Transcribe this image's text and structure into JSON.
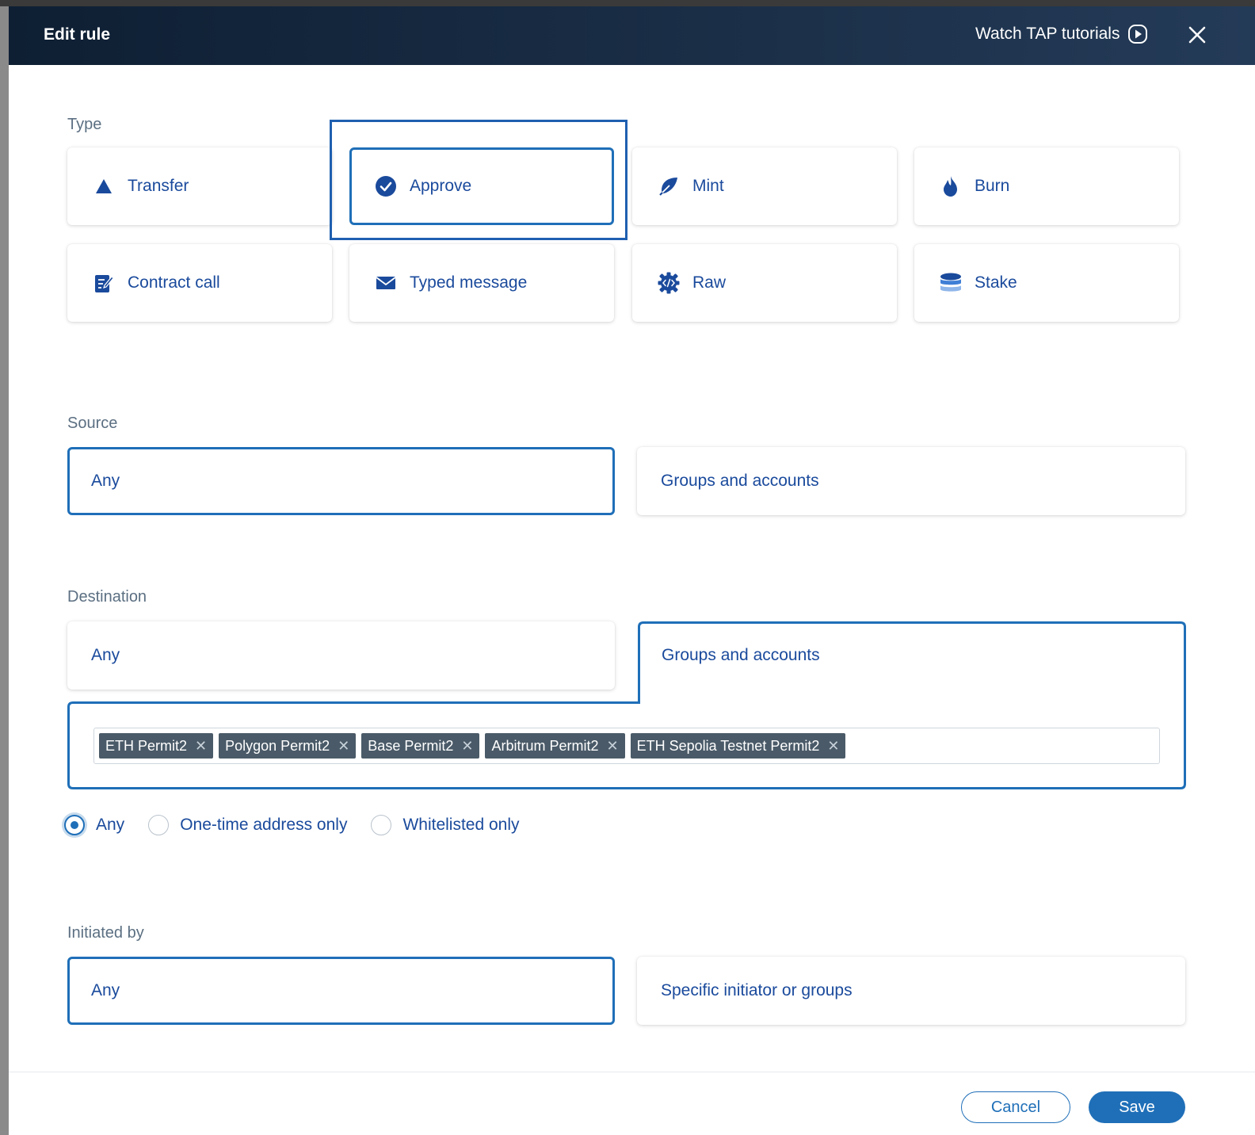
{
  "header": {
    "title": "Edit rule",
    "tutorials_label": "Watch TAP tutorials"
  },
  "type": {
    "label": "Type",
    "options": [
      {
        "label": "Transfer",
        "icon": "triangle-icon"
      },
      {
        "label": "Approve",
        "icon": "check-circle-icon",
        "selected": true
      },
      {
        "label": "Mint",
        "icon": "leaf-icon"
      },
      {
        "label": "Burn",
        "icon": "flame-icon"
      },
      {
        "label": "Contract call",
        "icon": "document-edit-icon"
      },
      {
        "label": "Typed message",
        "icon": "envelope-icon"
      },
      {
        "label": "Raw",
        "icon": "code-gear-icon"
      },
      {
        "label": "Stake",
        "icon": "database-stack-icon"
      }
    ]
  },
  "source": {
    "label": "Source",
    "options": [
      "Any",
      "Groups and accounts"
    ],
    "selected": "Any"
  },
  "destination": {
    "label": "Destination",
    "options": [
      "Any",
      "Groups and accounts"
    ],
    "selected": "Groups and accounts",
    "tags": [
      "ETH Permit2",
      "Polygon Permit2",
      "Base Permit2",
      "Arbitrum Permit2",
      "ETH Sepolia Testnet Permit2"
    ],
    "address_filter": {
      "options": [
        "Any",
        "One-time address only",
        "Whitelisted only"
      ],
      "selected": "Any"
    }
  },
  "initiated_by": {
    "label": "Initiated by",
    "options": [
      "Any",
      "Specific initiator or groups"
    ],
    "selected": "Any"
  },
  "footer": {
    "cancel_label": "Cancel",
    "save_label": "Save"
  },
  "colors": {
    "accent": "#1f6fb8",
    "text_blue": "#1a4a9c",
    "header_bg": "#0e1f33",
    "tag_bg": "#4a5a68"
  }
}
